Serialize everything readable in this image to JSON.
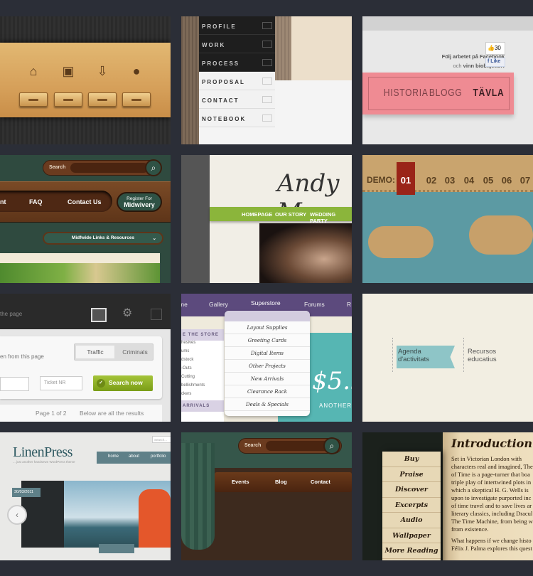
{
  "tiles": {
    "wood_drawers": {
      "icons": [
        "home-icon",
        "briefcase-icon",
        "download-document-icon",
        "person-icon"
      ]
    },
    "dark_menu": {
      "items": [
        "PROFILE",
        "WORK",
        "PROCESS",
        "PROPOSAL",
        "CONTACT",
        "NOTEBOOK"
      ]
    },
    "pink_ribbon": {
      "fb_line1": "Följ arbetet på Facebook",
      "fb_line2_pre": "och",
      "fb_line2_bold": "vinn biobiljetter!",
      "like_count": "30",
      "like_label": "Like",
      "nav": [
        "HISTORIA",
        "BLOGG",
        "TÄVLA"
      ]
    },
    "midwife": {
      "search_label": "Search",
      "nav": [
        "nt",
        "FAQ",
        "Contact Us"
      ],
      "register_line1": "Register For",
      "register_line2": "Midwivery",
      "dropdown": "Midfwide Links & Resources"
    },
    "wedding": {
      "title": "Andy M",
      "nav": [
        "HOMEPAGE",
        "OUR STORY",
        "WEDDING PARTY"
      ]
    },
    "cardboard": {
      "demo_label": "DEMO:",
      "numbers": [
        "01",
        "02",
        "03",
        "04",
        "05",
        "06",
        "07"
      ],
      "accent": "#9a2418"
    },
    "police": {
      "header_text": "the page",
      "subtitle": "en from this page",
      "seg": [
        "Traffic",
        "Criminals"
      ],
      "ticket_placeholder": "Ticket NR",
      "search_button": "Search now",
      "pagination": "Page 1 of 2",
      "results": "Below are all the results"
    },
    "superstore": {
      "nav": [
        "me",
        "Gallery",
        "Superstore",
        "Forums",
        "R"
      ],
      "dropdown": [
        "Layout Supplies",
        "Greeting Cards",
        "Digital Items",
        "Other Projects",
        "New Arrivals",
        "Clearance Rack",
        "Deals & Specials"
      ],
      "sidebar_header": "E THE STORE",
      "sidebar_items": [
        "hesives",
        "ums",
        "dstock",
        "-Outs",
        "Cutting",
        "bellishments",
        "ckers"
      ],
      "sidebar_footer": "ARRIVALS",
      "price": "$5.9",
      "promo": "ANOTHER"
    },
    "agenda": {
      "active": "Agenda d'activitats",
      "other": "Recursos educatius"
    },
    "linenpress": {
      "logo": "LinenPress",
      "tagline": "... just another handsewn WordPress theme",
      "search_placeholder": "Search...",
      "nav": [
        "home",
        "about",
        "portfolio"
      ],
      "date": "30/03/2011"
    },
    "wood_nav": {
      "search_label": "Search",
      "nav": [
        "Events",
        "Blog",
        "Contact"
      ]
    },
    "book": {
      "menu": [
        "Buy",
        "Praise",
        "Discover",
        "Excerpts",
        "Audio",
        "Wallpaper",
        "More Reading"
      ],
      "heading": "Introduction",
      "body": [
        "Set in Victorian London with",
        "characters real and imagined, The",
        "of Time is a page-turner that boa",
        "triple play of intertwined plots in",
        "which a skeptical H. G. Wells is",
        "upon to investigate purported inc",
        "of time travel and to save lives ar",
        "literary classics, including Dracul",
        "The Time Machine, from being w",
        "from existence.",
        "",
        "What happens if we change histo",
        "Félix J. Palma explores this quest"
      ]
    }
  }
}
